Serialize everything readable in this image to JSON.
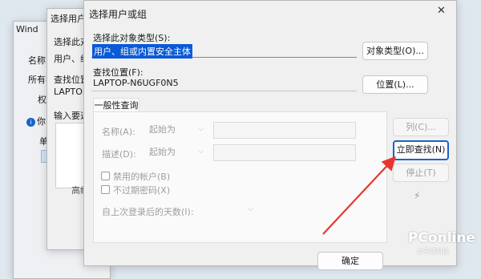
{
  "back_window_1": {
    "title": "Wind",
    "labels": [
      "名称",
      "所有者",
      "权"
    ],
    "info": "你",
    "sub": "单"
  },
  "back_window_2": {
    "title": "选择用户或",
    "object_type_label": "选择此对",
    "object_type_value": "用户、组",
    "location_label": "查找位置",
    "location_value": "LAPTOP",
    "input_label": "输入要选",
    "adv_button": "高级"
  },
  "dialog": {
    "title": "选择用户或组",
    "close_glyph": "✕",
    "object_type": {
      "label": "选择此对象类型(S):",
      "value": "用户、组或内置安全主体",
      "button": "对象类型(O)..."
    },
    "location": {
      "label": "查找位置(F):",
      "value": "LAPTOP-N6UGF0N5",
      "button": "位置(L)..."
    },
    "tab": "一般性查询",
    "query": {
      "name_label": "名称(A):",
      "name_mode": "起始为",
      "desc_label": "描述(D):",
      "desc_mode": "起始为",
      "disabled_accounts": "禁用的帐户(B)",
      "non_expiring": "不过期密码(X)",
      "days_label": "自上次登录后的天数(I):"
    },
    "buttons": {
      "columns": "列(C)...",
      "find_now": "立即查找(N)",
      "stop": "停止(T)"
    },
    "bottom_button": "确定"
  },
  "watermark": {
    "brand": "PConline",
    "sub": "太平洋科技"
  },
  "colors": {
    "accent": "#1a63c7",
    "selection": "#0a5ad6",
    "arrow": "#e8362f"
  }
}
